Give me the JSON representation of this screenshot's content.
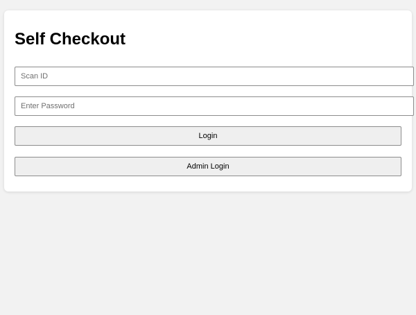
{
  "page": {
    "title": "Self Checkout"
  },
  "form": {
    "scan_id_placeholder": "Scan ID",
    "scan_id_value": "",
    "password_placeholder": "Enter Password",
    "password_value": "",
    "login_label": "Login",
    "admin_login_label": "Admin Login"
  },
  "colors": {
    "background": "#f2f2f2",
    "card": "#ffffff",
    "button_bg": "#efefef",
    "border": "#8c8c8c"
  }
}
